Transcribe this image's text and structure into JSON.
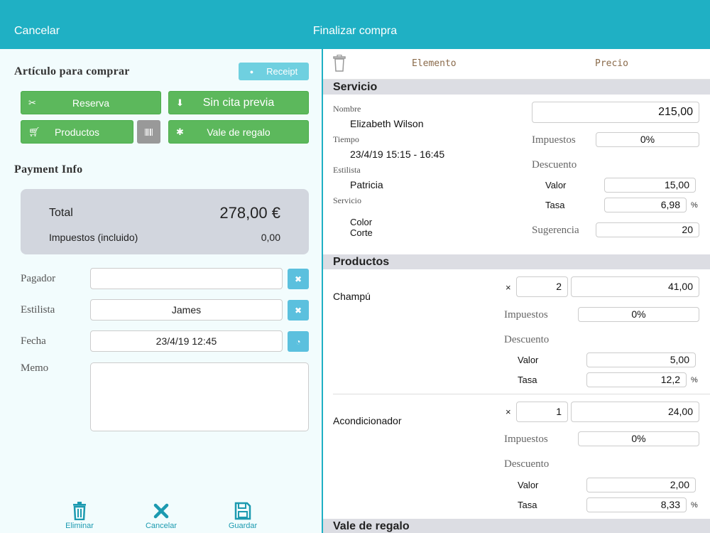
{
  "topbar": {
    "cancel": "Cancelar",
    "title": "Finalizar compra"
  },
  "left": {
    "items_heading": "Artículo para comprar",
    "receipt_label": "Receipt",
    "buttons": {
      "reserva": "Reserva",
      "sin_cita": "Sin cita previa",
      "productos": "Productos",
      "vale": "Vale de regalo"
    },
    "payment_heading": "Payment Info",
    "total_label": "Total",
    "total_value": "278,00 €",
    "tax_label": "Impuestos (incluido)",
    "tax_value": "0,00",
    "fields": {
      "pagador_label": "Pagador",
      "pagador_value": "",
      "estilista_label": "Estilista",
      "estilista_value": "James",
      "fecha_label": "Fecha",
      "fecha_value": "23/4/19 12:45",
      "memo_label": "Memo"
    },
    "bottom": {
      "delete": "Eliminar",
      "cancel": "Cancelar",
      "save": "Guardar"
    }
  },
  "right": {
    "col_item": "Elemento",
    "col_price": "Precio",
    "servicio": {
      "heading": "Servicio",
      "nombre_label": "Nombre",
      "nombre_value": "Elizabeth Wilson",
      "tiempo_label": "Tiempo",
      "tiempo_value": "23/4/19 15:15 - 16:45",
      "estilista_label": "Estilista",
      "estilista_value": "Patricia",
      "servicio_label": "Servicio",
      "servicio_values": [
        "Color",
        "Corte"
      ],
      "price": "215,00",
      "impuestos_label": "Impuestos",
      "impuestos_value": "0%",
      "descuento_label": "Descuento",
      "valor_label": "Valor",
      "valor_value": "15,00",
      "tasa_label": "Tasa",
      "tasa_value": "6,98",
      "pct": "%",
      "sugerencia_label": "Sugerencia",
      "sugerencia_value": "20"
    },
    "productos": {
      "heading": "Productos",
      "items": [
        {
          "name": "Champú",
          "qty": "2",
          "price": "41,00",
          "impuestos": "0%",
          "valor": "5,00",
          "tasa": "12,2"
        },
        {
          "name": "Acondicionador",
          "qty": "1",
          "price": "24,00",
          "impuestos": "0%",
          "valor": "2,00",
          "tasa": "8,33"
        }
      ],
      "times": "×",
      "impuestos_label": "Impuestos",
      "descuento_label": "Descuento",
      "valor_label": "Valor",
      "tasa_label": "Tasa",
      "pct": "%"
    },
    "vale": {
      "heading": "Vale de regalo"
    }
  }
}
